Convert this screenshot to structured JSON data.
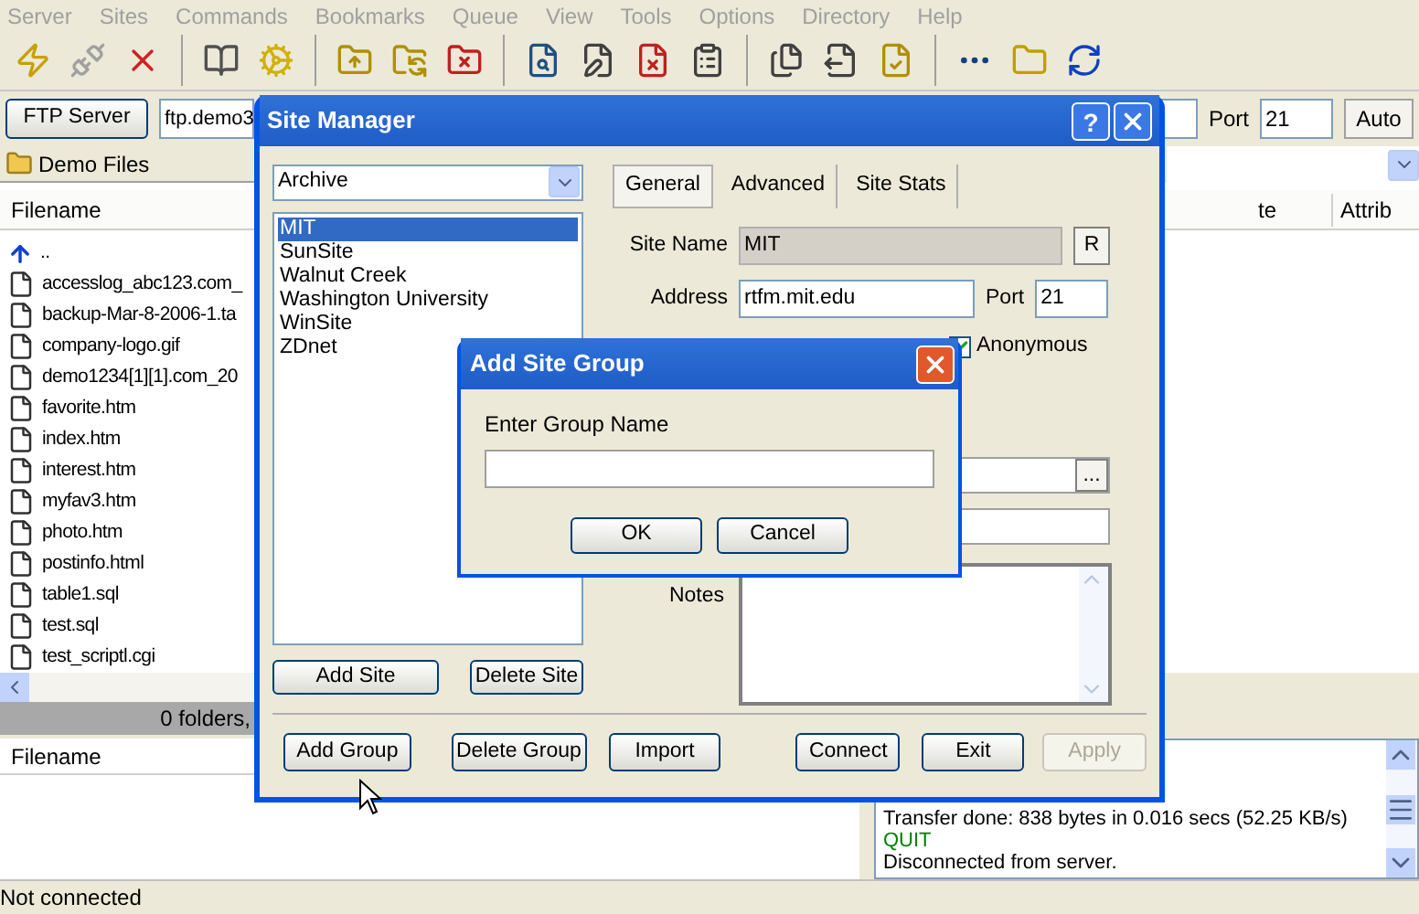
{
  "menu": [
    "Server",
    "Sites",
    "Commands",
    "Bookmarks",
    "Queue",
    "View",
    "Tools",
    "Options",
    "Directory",
    "Help"
  ],
  "connection": {
    "server_button": "FTP Server",
    "host": "ftp.demo3",
    "port_label": "Port",
    "port": "21",
    "mode_button": "Auto"
  },
  "local_path": "Demo Files",
  "local_files": {
    "columns": [
      "Filename"
    ],
    "rows": [
      {
        "name": "..",
        "kind": "up"
      },
      {
        "name": "accesslog_abc123.com_",
        "kind": "file"
      },
      {
        "name": "backup-Mar-8-2006-1.ta",
        "kind": "file"
      },
      {
        "name": "company-logo.gif",
        "kind": "file"
      },
      {
        "name": "demo1234[1][1].com_20",
        "kind": "file"
      },
      {
        "name": "favorite.htm",
        "kind": "file"
      },
      {
        "name": "index.htm",
        "kind": "file"
      },
      {
        "name": "interest.htm",
        "kind": "file"
      },
      {
        "name": "myfav3.htm",
        "kind": "file"
      },
      {
        "name": "photo.htm",
        "kind": "file"
      },
      {
        "name": "postinfo.html",
        "kind": "file"
      },
      {
        "name": "table1.sql",
        "kind": "file"
      },
      {
        "name": "test.sql",
        "kind": "file"
      },
      {
        "name": "test_scriptl.cgi",
        "kind": "file"
      }
    ]
  },
  "local_status": "0 folders,",
  "remote_files": {
    "columns": [
      "te",
      "Attrib"
    ]
  },
  "queue": {
    "columns": [
      "Filename"
    ]
  },
  "log": [
    {
      "text": "Transfer done: 838 bytes in 0.016 secs (52.25 KB/s)",
      "kind": "info"
    },
    {
      "text": "QUIT",
      "kind": "command"
    },
    {
      "text": "Disconnected from server.",
      "kind": "info"
    }
  ],
  "status_bar": "Not connected",
  "site_manager": {
    "title": "Site Manager",
    "help_button": "?",
    "group": "Archive",
    "tabs": [
      {
        "label": "General",
        "selected": true
      },
      {
        "label": "Advanced",
        "selected": false
      },
      {
        "label": "Site Stats",
        "selected": false
      }
    ],
    "sites": [
      {
        "name": "MIT",
        "selected": true
      },
      {
        "name": "SunSite",
        "selected": false
      },
      {
        "name": "Walnut Creek",
        "selected": false
      },
      {
        "name": "Washington University",
        "selected": false
      },
      {
        "name": "WinSite",
        "selected": false
      },
      {
        "name": "ZDnet",
        "selected": false
      }
    ],
    "site_buttons": [
      "Add Site",
      "Delete Site"
    ],
    "site_name_label": "Site Name",
    "site_name": "MIT",
    "rename_button": "R",
    "address_label": "Address",
    "address": "rtfm.mit.edu",
    "port_label": "Port",
    "port": "21",
    "anonymous": {
      "label": "Anonymous",
      "checked": true
    },
    "browse_button": "...",
    "notes_label": "Notes",
    "buttons": [
      {
        "label": "Add Group",
        "disabled": false
      },
      {
        "label": "Delete Group",
        "disabled": false
      },
      {
        "label": "Import",
        "disabled": false
      },
      {
        "label": "Connect",
        "disabled": false
      },
      {
        "label": "Exit",
        "disabled": false
      },
      {
        "label": "Apply",
        "disabled": true
      }
    ]
  },
  "add_site_group": {
    "title": "Add Site Group",
    "field_label": "Enter Group Name",
    "buttons": [
      "OK",
      "Cancel"
    ]
  }
}
